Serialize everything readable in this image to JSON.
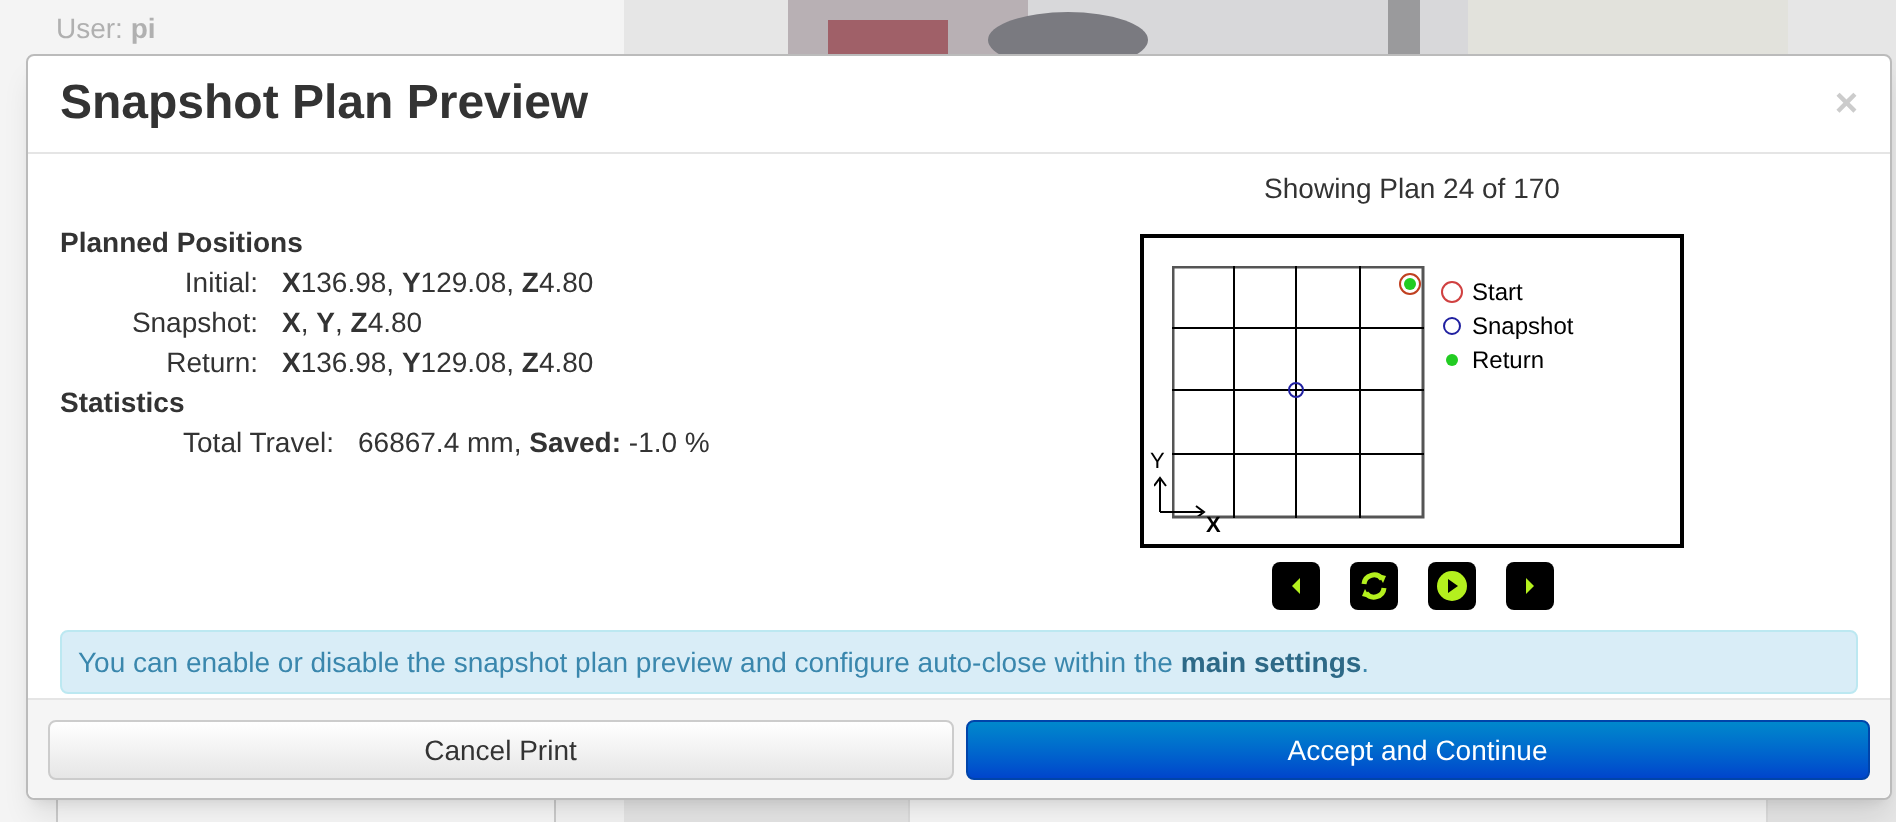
{
  "background": {
    "user_label": "User:",
    "user_name": "pi"
  },
  "dialog": {
    "title": "Snapshot Plan Preview",
    "close": "×",
    "sections": [
      {
        "heading": "Planned Positions",
        "rows": [
          {
            "label": "Initial:",
            "value": "**X**136.98, **Y**129.08, **Z**4.80"
          },
          {
            "label": "Snapshot:",
            "value": "**X**, **Y**, **Z**4.80"
          },
          {
            "label": "Return:",
            "value": "**X**136.98, **Y**129.08, **Z**4.80"
          }
        ]
      },
      {
        "heading": "Statistics",
        "rows": [
          {
            "label": "Total Travel:",
            "value": "66867.4 mm, **Saved:** -1.0 %"
          }
        ]
      }
    ],
    "plan_caption": "Showing Plan 24 of 170",
    "plot": {
      "y_axis": "Y",
      "x_axis": "X",
      "legend": [
        {
          "kind": "start",
          "label": "Start"
        },
        {
          "kind": "snapshot",
          "label": "Snapshot"
        },
        {
          "kind": "return",
          "label": "Return"
        }
      ]
    },
    "controls": [
      {
        "kind": "previous"
      },
      {
        "kind": "refresh"
      },
      {
        "kind": "play"
      },
      {
        "kind": "next"
      }
    ],
    "info": {
      "text": "You can enable or disable the snapshot plan preview and configure auto-close within the",
      "link": "main settings",
      "end": "."
    },
    "buttons": [
      {
        "kind": "secondary",
        "label": "Cancel Print"
      },
      {
        "kind": "primary",
        "label": "Accept and Continue"
      }
    ]
  }
}
